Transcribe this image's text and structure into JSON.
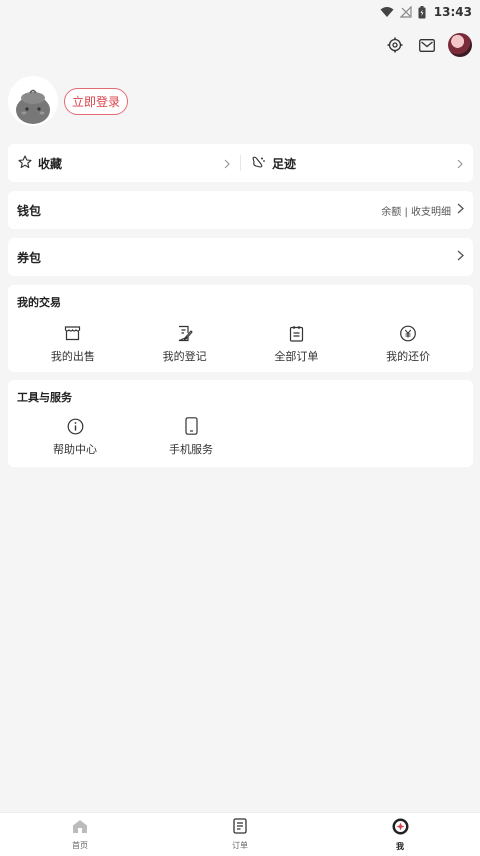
{
  "status_bar": {
    "time": "13:43",
    "icons": [
      "wifi-icon",
      "no-signal-icon",
      "battery-icon"
    ]
  },
  "top_actions": {
    "icons": [
      "settings-icon",
      "mail-icon"
    ],
    "avatar": "user-avatar"
  },
  "profile": {
    "login_label": "立即登录"
  },
  "favorites": {
    "collect_label": "收藏",
    "footprint_label": "足迹"
  },
  "wallet": {
    "title": "钱包",
    "detail": "余额 | 收支明细"
  },
  "coupon": {
    "title": "券包"
  },
  "trade": {
    "title": "我的交易",
    "items": [
      {
        "label": "我的出售",
        "icon": "store-icon"
      },
      {
        "label": "我的登记",
        "icon": "register-icon"
      },
      {
        "label": "全部订单",
        "icon": "orders-icon"
      },
      {
        "label": "我的还价",
        "icon": "yen-bubble-icon"
      }
    ]
  },
  "tools": {
    "title": "工具与服务",
    "items": [
      {
        "label": "帮助中心",
        "icon": "info-icon"
      },
      {
        "label": "手机服务",
        "icon": "phone-icon"
      }
    ]
  },
  "tabbar": {
    "tabs": [
      {
        "label": "首页",
        "icon": "home-icon"
      },
      {
        "label": "订单",
        "icon": "order-doc-icon"
      },
      {
        "label": "我",
        "icon": "me-icon",
        "active": true
      }
    ]
  },
  "colors": {
    "accent": "#d9434d",
    "background": "#f5f5f5",
    "card": "#ffffff"
  }
}
